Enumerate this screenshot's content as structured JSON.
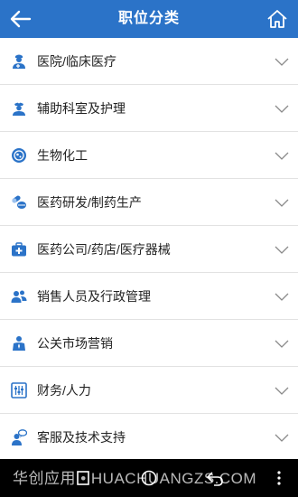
{
  "header": {
    "title": "职位分类",
    "back_icon": "back-arrow-icon",
    "home_icon": "home-icon"
  },
  "categories": [
    {
      "label": "医院/临床医疗",
      "icon": "doctor-icon"
    },
    {
      "label": "辅助科室及护理",
      "icon": "nurse-icon"
    },
    {
      "label": "生物化工",
      "icon": "cell-icon"
    },
    {
      "label": "医药研发/制药生产",
      "icon": "pills-icon"
    },
    {
      "label": "医药公司/药店/医疗器械",
      "icon": "medkit-icon"
    },
    {
      "label": "销售人员及行政管理",
      "icon": "people-icon"
    },
    {
      "label": "公关市场营销",
      "icon": "presenter-icon"
    },
    {
      "label": "财务/人力",
      "icon": "finance-icon"
    },
    {
      "label": "客服及技术支持",
      "icon": "support-icon"
    }
  ],
  "watermark": "华创应用 • HUACHUANGZS.COM",
  "colors": {
    "header_bg": "#2b73c8",
    "icon": "#2b73c8",
    "chevron": "#8a8a8a"
  }
}
